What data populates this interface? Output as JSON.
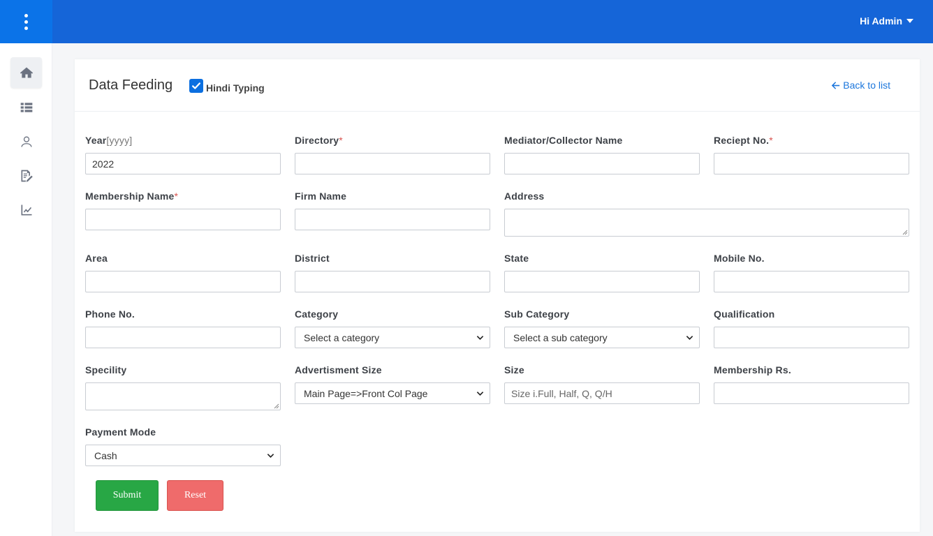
{
  "header": {
    "user_greeting": "Hi Admin"
  },
  "sidebar": {
    "items": [
      {
        "name": "home-icon",
        "active": true
      },
      {
        "name": "table-icon",
        "active": false
      },
      {
        "name": "user-icon",
        "active": false
      },
      {
        "name": "edit-document-icon",
        "active": false
      },
      {
        "name": "chart-icon",
        "active": false
      }
    ]
  },
  "page": {
    "title": "Data Feeding",
    "hindi_typing_label": "Hindi Typing",
    "hindi_typing_checked": true,
    "back_label": "Back to list"
  },
  "form": {
    "year": {
      "label": "Year",
      "hint": "[yyyy]",
      "value": "2022"
    },
    "directory": {
      "label": "Directory",
      "required": "*",
      "value": ""
    },
    "mediator": {
      "label": "Mediator/Collector Name",
      "value": ""
    },
    "receipt": {
      "label": "Reciept No.",
      "required": "*",
      "value": ""
    },
    "membership_name": {
      "label": "Membership Name",
      "required": "*",
      "value": ""
    },
    "firm_name": {
      "label": "Firm Name",
      "value": ""
    },
    "address": {
      "label": "Address",
      "value": ""
    },
    "area": {
      "label": "Area",
      "value": ""
    },
    "district": {
      "label": "District",
      "value": ""
    },
    "state": {
      "label": "State",
      "value": ""
    },
    "mobile": {
      "label": "Mobile No.",
      "value": ""
    },
    "phone": {
      "label": "Phone No.",
      "value": ""
    },
    "category": {
      "label": "Category",
      "selected": "Select a category"
    },
    "sub_category": {
      "label": "Sub Category",
      "selected": "Select a sub category"
    },
    "qualification": {
      "label": "Qualification",
      "value": ""
    },
    "speciality": {
      "label": "Specility",
      "value": ""
    },
    "ad_size": {
      "label": "Advertisment Size",
      "selected": "Main Page=>Front Col Page"
    },
    "size": {
      "label": "Size",
      "placeholder": "Size i.Full, Half, Q, Q/H"
    },
    "membership_rs": {
      "label": "Membership Rs.",
      "value": ""
    },
    "payment_mode": {
      "label": "Payment Mode",
      "selected": "Cash"
    }
  },
  "buttons": {
    "submit": "Submit",
    "reset": "Reset"
  },
  "colors": {
    "topbar": "#1565d8",
    "accent": "#0b6fe0",
    "submit": "#28a745",
    "reset": "#ef6b6b"
  }
}
